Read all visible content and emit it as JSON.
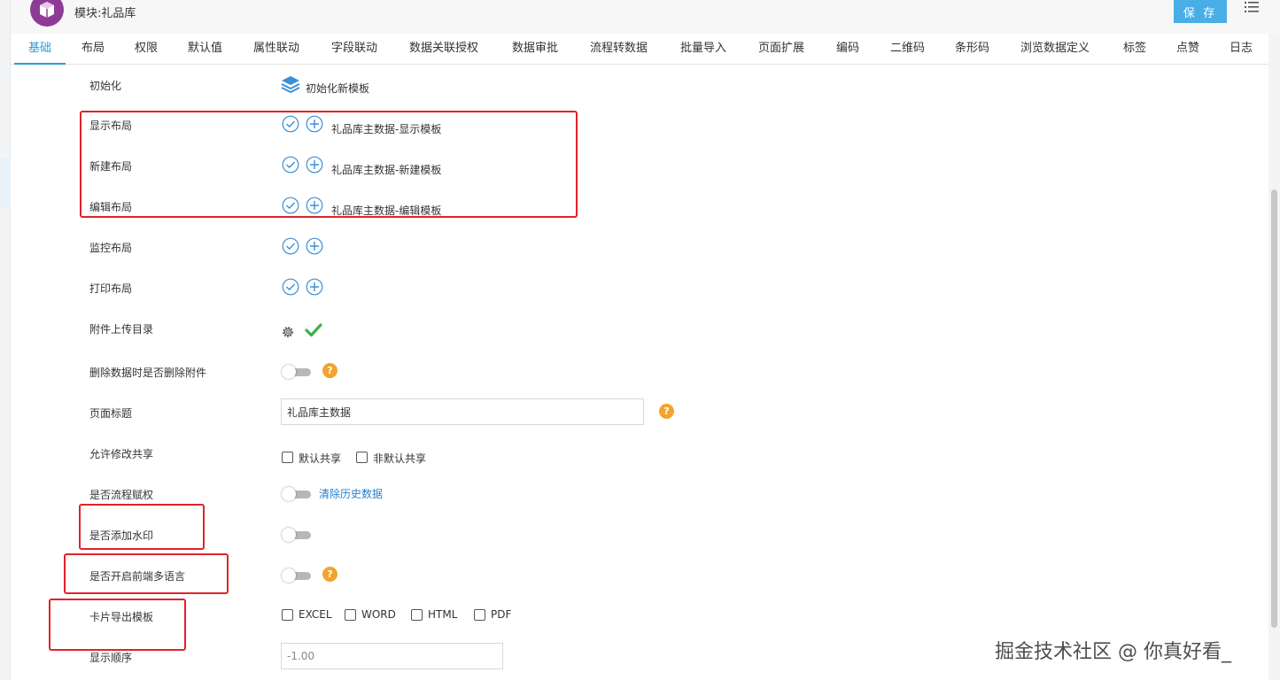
{
  "header": {
    "title": "模块:礼品库",
    "save_label": "保 存",
    "logo_icon": "cube-icon",
    "menu_icon": "list-icon"
  },
  "tabs": [
    "基础",
    "布局",
    "权限",
    "默认值",
    "属性联动",
    "字段联动",
    "数据关联授权",
    "数据审批",
    "流程转数据",
    "批量导入",
    "页面扩展",
    "编码",
    "二维码",
    "条形码",
    "浏览数据定义",
    "标签",
    "点赞",
    "日志"
  ],
  "active_tab": "基础",
  "form": {
    "init": {
      "label": "初始化",
      "action": "初始化新模板"
    },
    "display_layout": {
      "label": "显示布局",
      "template": "礼品库主数据-显示模板"
    },
    "new_layout": {
      "label": "新建布局",
      "template": "礼品库主数据-新建模板"
    },
    "edit_layout": {
      "label": "编辑布局",
      "template": "礼品库主数据-编辑模板"
    },
    "monitor_layout": {
      "label": "监控布局"
    },
    "print_layout": {
      "label": "打印布局"
    },
    "attachment_dir": {
      "label": "附件上传目录"
    },
    "delete_attachments": {
      "label": "删除数据时是否删除附件",
      "on": false
    },
    "page_title": {
      "label": "页面标题",
      "value": "礼品库主数据"
    },
    "allow_share": {
      "label": "允许修改共享",
      "options": [
        "默认共享",
        "非默认共享"
      ]
    },
    "flow_grant": {
      "label": "是否流程赋权",
      "on": false,
      "link": "清除历史数据"
    },
    "watermark": {
      "label": "是否添加水印",
      "on": false
    },
    "frontend_i18n": {
      "label": "是否开启前端多语言",
      "on": false
    },
    "card_export": {
      "label": "卡片导出模板",
      "options": [
        "EXCEL",
        "WORD",
        "HTML",
        "PDF"
      ]
    },
    "display_order": {
      "label": "显示顺序",
      "value": "-1.00"
    }
  },
  "help_mark": "?",
  "overlay_watermark": "掘金技术社区 @ 你真好看_",
  "colors": {
    "accent": "#2a9bd6",
    "save": "#4aaee6",
    "highlight_box": "#e0232a",
    "check": "#3cb14a",
    "help": "#f2a42c"
  }
}
